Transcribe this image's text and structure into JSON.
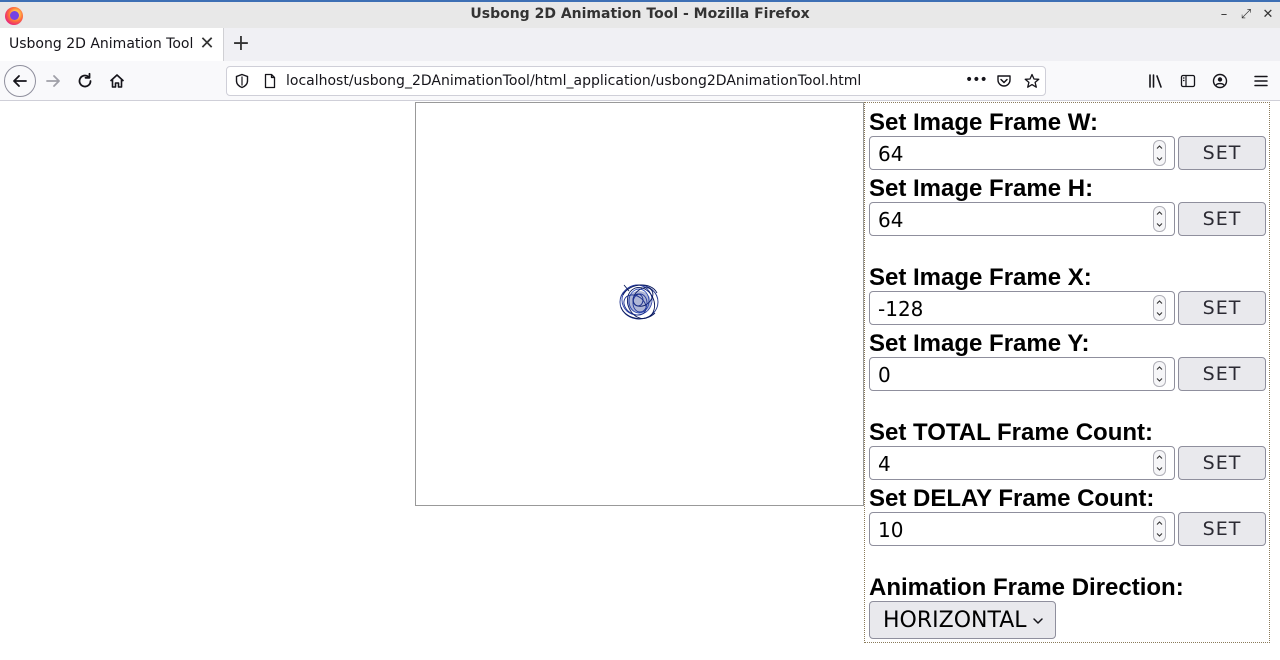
{
  "window": {
    "title": "Usbong 2D Animation Tool - Mozilla Firefox",
    "minimize_glyph": "–",
    "maximize_glyph": "⤢",
    "close_glyph": "✕"
  },
  "tabs": [
    {
      "label": "Usbong 2D Animation Tool",
      "close_glyph": "✕"
    }
  ],
  "new_tab_glyph": "+",
  "navigation": {
    "url": "localhost/usbong_2DAnimationTool/html_application/usbong2DAnimationTool.html",
    "page_actions_glyph": "•••"
  },
  "icons": {
    "back": "arrow-left-icon",
    "forward": "arrow-right-icon",
    "reload": "reload-icon",
    "home": "home-icon",
    "shield": "shield-icon",
    "page": "page-icon",
    "pocket": "pocket-icon",
    "bookmark": "star-icon",
    "library": "library-icon",
    "sidebar": "sidebar-icon",
    "account": "account-icon",
    "menu": "hamburger-menu-icon"
  },
  "controls": {
    "frame_w": {
      "label": "Set Image Frame W:",
      "value": "64",
      "button": "SET"
    },
    "frame_h": {
      "label": "Set Image Frame H:",
      "value": "64",
      "button": "SET"
    },
    "frame_x": {
      "label": "Set Image Frame X:",
      "value": "-128",
      "button": "SET"
    },
    "frame_y": {
      "label": "Set Image Frame Y:",
      "value": "0",
      "button": "SET"
    },
    "total_frames": {
      "label": "Set TOTAL Frame Count:",
      "value": "4",
      "button": "SET"
    },
    "delay_frames": {
      "label": "Set DELAY Frame Count:",
      "value": "10",
      "button": "SET"
    },
    "direction": {
      "label": "Animation Frame Direction:",
      "value": "HORIZONTAL"
    }
  },
  "colors": {
    "accent": "#3d6fb4",
    "sprite": "#1a2f8a"
  }
}
